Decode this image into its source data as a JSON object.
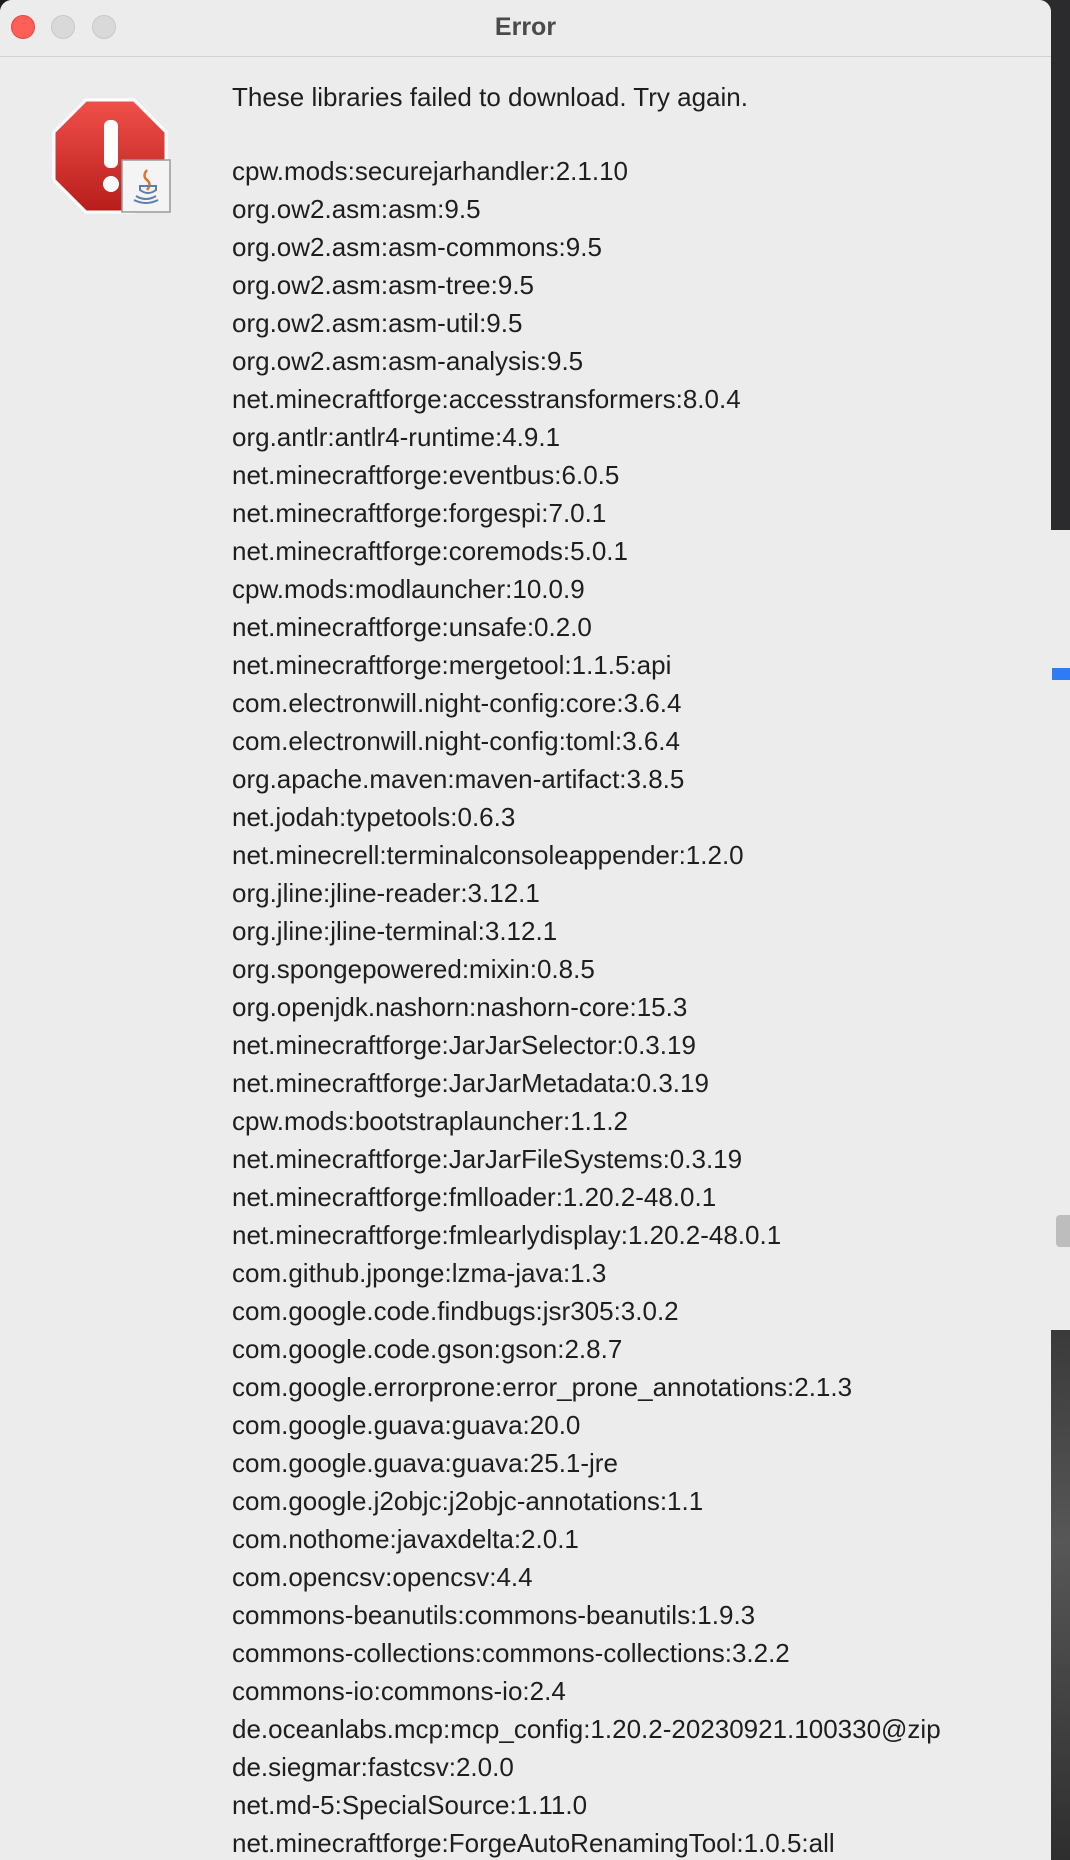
{
  "window": {
    "title": "Error"
  },
  "dialog": {
    "icon": "error-stop-sign-with-java-badge",
    "message": "These libraries failed to download. Try again.",
    "libraries": [
      "cpw.mods:securejarhandler:2.1.10",
      "org.ow2.asm:asm:9.5",
      "org.ow2.asm:asm-commons:9.5",
      "org.ow2.asm:asm-tree:9.5",
      "org.ow2.asm:asm-util:9.5",
      "org.ow2.asm:asm-analysis:9.5",
      "net.minecraftforge:accesstransformers:8.0.4",
      "org.antlr:antlr4-runtime:4.9.1",
      "net.minecraftforge:eventbus:6.0.5",
      "net.minecraftforge:forgespi:7.0.1",
      "net.minecraftforge:coremods:5.0.1",
      "cpw.mods:modlauncher:10.0.9",
      "net.minecraftforge:unsafe:0.2.0",
      "net.minecraftforge:mergetool:1.1.5:api",
      "com.electronwill.night-config:core:3.6.4",
      "com.electronwill.night-config:toml:3.6.4",
      "org.apache.maven:maven-artifact:3.8.5",
      "net.jodah:typetools:0.6.3",
      "net.minecrell:terminalconsoleappender:1.2.0",
      "org.jline:jline-reader:3.12.1",
      "org.jline:jline-terminal:3.12.1",
      "org.spongepowered:mixin:0.8.5",
      "org.openjdk.nashorn:nashorn-core:15.3",
      "net.minecraftforge:JarJarSelector:0.3.19",
      "net.minecraftforge:JarJarMetadata:0.3.19",
      "cpw.mods:bootstraplauncher:1.1.2",
      "net.minecraftforge:JarJarFileSystems:0.3.19",
      "net.minecraftforge:fmlloader:1.20.2-48.0.1",
      "net.minecraftforge:fmlearlydisplay:1.20.2-48.0.1",
      "com.github.jponge:lzma-java:1.3",
      "com.google.code.findbugs:jsr305:3.0.2",
      "com.google.code.gson:gson:2.8.7",
      "com.google.errorprone:error_prone_annotations:2.1.3",
      "com.google.guava:guava:20.0",
      "com.google.guava:guava:25.1-jre",
      "com.google.j2objc:j2objc-annotations:1.1",
      "com.nothome:javaxdelta:2.0.1",
      "com.opencsv:opencsv:4.4",
      "commons-beanutils:commons-beanutils:1.9.3",
      "commons-collections:commons-collections:3.2.2",
      "commons-io:commons-io:2.4",
      "de.oceanlabs.mcp:mcp_config:1.20.2-20230921.100330@zip",
      "de.siegmar:fastcsv:2.0.0",
      "net.md-5:SpecialSource:1.11.0",
      "net.minecraftforge:ForgeAutoRenamingTool:1.0.5:all"
    ]
  },
  "colors": {
    "window_background": "#ececec",
    "close_button": "#fe5f57",
    "error_icon_red": "#d8322e",
    "text": "#1e1e1e"
  }
}
